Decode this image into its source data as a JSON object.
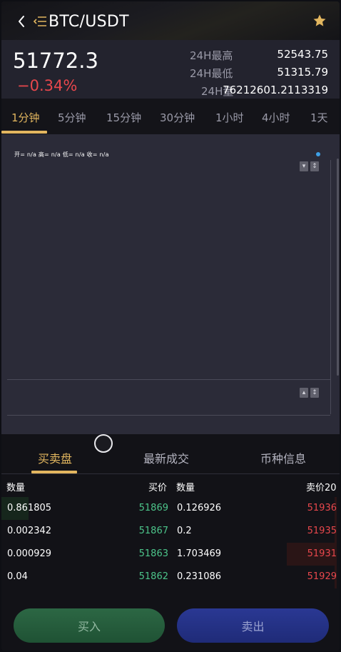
{
  "header": {
    "pair": "BTC/USDT",
    "icons": {
      "back": "chevron-left-icon",
      "menu": "list-menu-icon",
      "favorite": "star-icon"
    }
  },
  "ticker": {
    "last_price": "51772.3",
    "change_pct": "−0.34%",
    "high_label": "24H最高",
    "high_value": "52543.75",
    "low_label": "24H最低",
    "low_value": "51315.79",
    "volume_label": "24H量",
    "volume_value": "76212601.2113319"
  },
  "intervals": [
    {
      "label": "1分钟",
      "active": true
    },
    {
      "label": "5分钟"
    },
    {
      "label": "15分钟"
    },
    {
      "label": "30分钟"
    },
    {
      "label": "1小时"
    },
    {
      "label": "4小时"
    },
    {
      "label": "1天"
    }
  ],
  "chart": {
    "ohlc": "开= n/a  高= n/a  低= n/a  收= n/a"
  },
  "tabs": [
    {
      "label": "买卖盘",
      "active": true
    },
    {
      "label": "最新成交"
    },
    {
      "label": "币种信息"
    }
  ],
  "orderbook": {
    "headers": {
      "buy_qty": "数量",
      "buy_price": "买价",
      "sell_qty": "数量",
      "sell_price": "卖价20"
    },
    "rows": [
      {
        "buy_qty": "0.861805",
        "buy_price": "51869",
        "sell_qty": "0.126926",
        "sell_price": "51936",
        "buy_depth": 0.16,
        "sell_depth": 0.01
      },
      {
        "buy_qty": "0.002342",
        "buy_price": "51867",
        "sell_qty": "0.2",
        "sell_price": "51935",
        "buy_depth": 0.0,
        "sell_depth": 0.01
      },
      {
        "buy_qty": "0.000929",
        "buy_price": "51863",
        "sell_qty": "1.703469",
        "sell_price": "51931",
        "buy_depth": 0.0,
        "sell_depth": 0.3
      },
      {
        "buy_qty": "0.04",
        "buy_price": "51862",
        "sell_qty": "0.231086",
        "sell_price": "51929",
        "buy_depth": 0.0,
        "sell_depth": 0.01
      }
    ]
  },
  "actions": {
    "buy": "买入",
    "sell": "卖出"
  },
  "colors": {
    "accent": "#e2b65f",
    "up": "#4cc48a",
    "down": "#e8474c"
  }
}
